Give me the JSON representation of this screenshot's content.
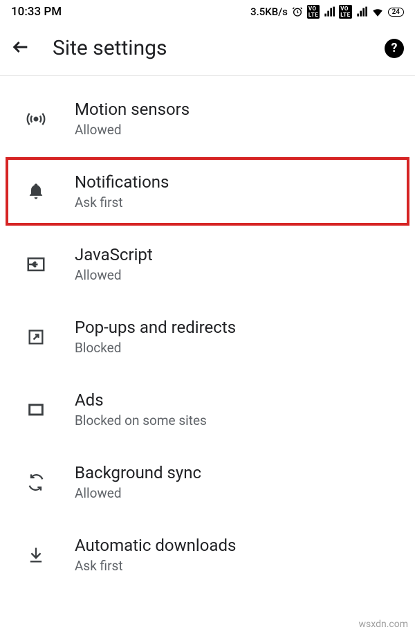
{
  "status": {
    "time": "10:33 PM",
    "speed": "3.5KB/s",
    "battery": "24"
  },
  "appbar": {
    "title": "Site settings"
  },
  "items": [
    {
      "title": "Motion sensors",
      "sub": "Allowed",
      "icon": "sensor",
      "highlight": false
    },
    {
      "title": "Notifications",
      "sub": "Ask first",
      "icon": "bell",
      "highlight": true
    },
    {
      "title": "JavaScript",
      "sub": "Allowed",
      "icon": "js",
      "highlight": false
    },
    {
      "title": "Pop-ups and redirects",
      "sub": "Blocked",
      "icon": "popup",
      "highlight": false
    },
    {
      "title": "Ads",
      "sub": "Blocked on some sites",
      "icon": "ads",
      "highlight": false
    },
    {
      "title": "Background sync",
      "sub": "Allowed",
      "icon": "sync",
      "highlight": false
    },
    {
      "title": "Automatic downloads",
      "sub": "Ask first",
      "icon": "download",
      "highlight": false
    }
  ],
  "watermark": "wsxdn.com"
}
